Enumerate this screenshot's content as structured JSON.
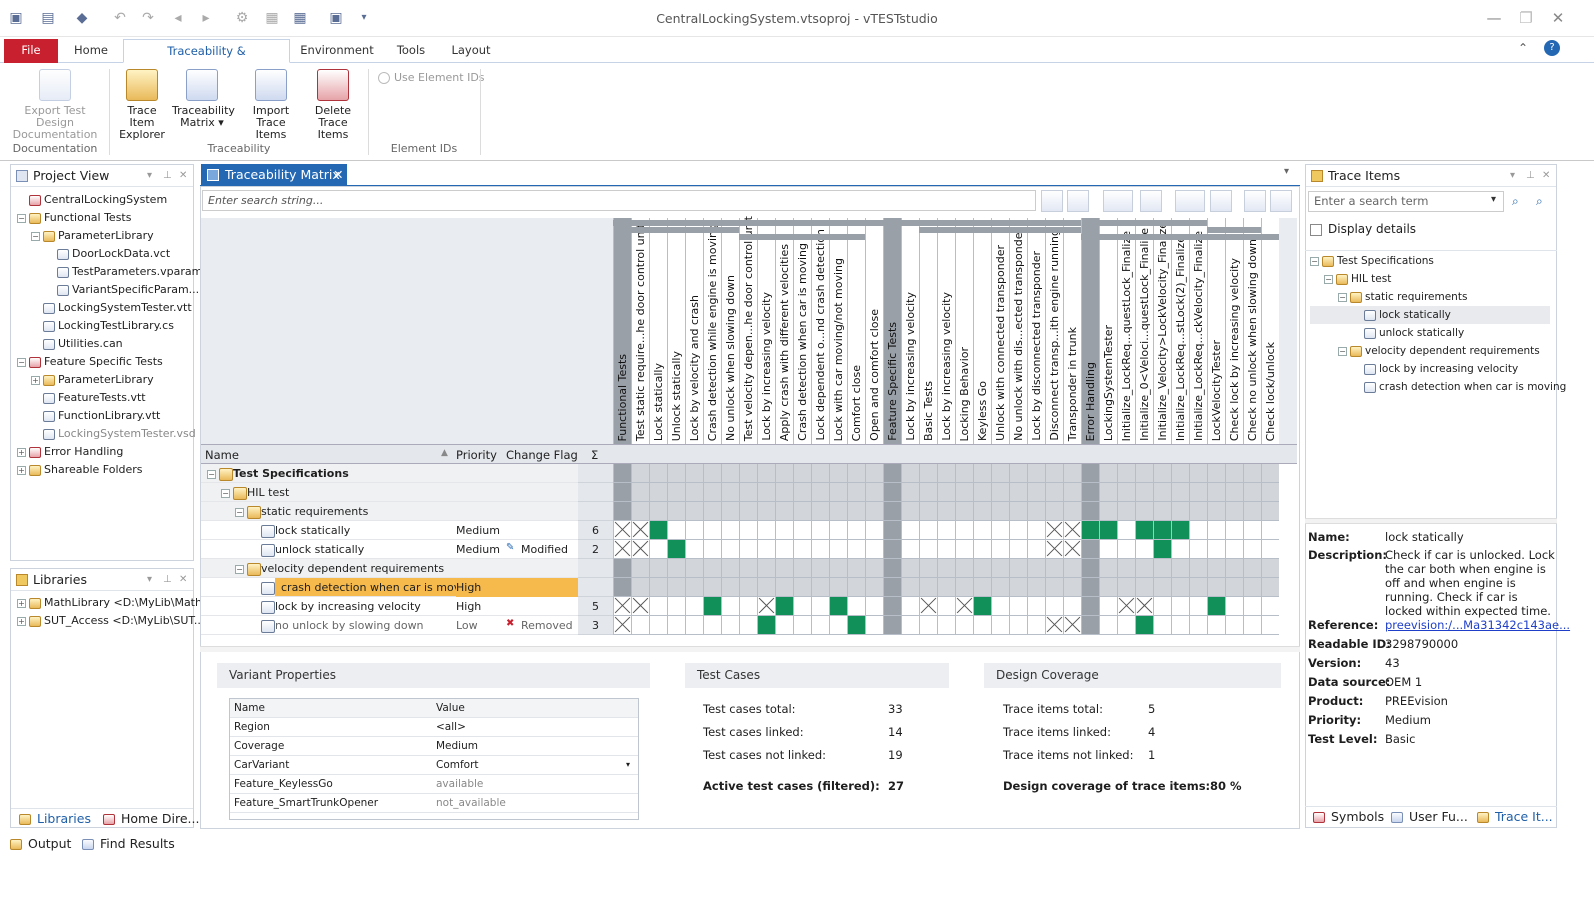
{
  "window": {
    "title": "CentralLockingSystem.vtsoproj - vTESTstudio"
  },
  "ribbon": {
    "tabs": [
      "File",
      "Home",
      "Traceability & Documentation",
      "Environment",
      "Tools",
      "Layout"
    ],
    "buttons": {
      "export": "Export Test Design Documentation",
      "trace_explorer": "Trace Item Explorer",
      "traceability_matrix": "Traceability Matrix ▾",
      "import": "Import Trace Items",
      "delete": "Delete Trace Items",
      "use_ids": "Use Element IDs"
    },
    "groups": [
      "Documentation",
      "Traceability",
      "Element IDs"
    ]
  },
  "project_view": {
    "title": "Project View",
    "items": [
      {
        "label": "CentralLockingSystem",
        "level": 0
      },
      {
        "label": "Functional Tests",
        "level": 0
      },
      {
        "label": "ParameterLibrary",
        "level": 1
      },
      {
        "label": "DoorLockData.vct",
        "level": 2
      },
      {
        "label": "TestParameters.vparam",
        "level": 2
      },
      {
        "label": "VariantSpecificParam...",
        "level": 2
      },
      {
        "label": "LockingSystemTester.vtt",
        "level": 1
      },
      {
        "label": "LockingTestLibrary.cs",
        "level": 1
      },
      {
        "label": "Utilities.can",
        "level": 1
      },
      {
        "label": "Feature Specific Tests",
        "level": 0
      },
      {
        "label": "ParameterLibrary",
        "level": 1
      },
      {
        "label": "FeatureTests.vtt",
        "level": 1
      },
      {
        "label": "FunctionLibrary.vtt",
        "level": 1
      },
      {
        "label": "LockingSystemTester.vsd",
        "level": 1
      },
      {
        "label": "Error Handling",
        "level": 0
      },
      {
        "label": "Shareable Folders",
        "level": 0
      }
    ]
  },
  "libraries": {
    "title": "Libraries",
    "items": [
      "MathLibrary <D:\\MyLib\\Math...",
      "SUT_Access <D:\\MyLib\\SUT..."
    ],
    "tabs": [
      "Libraries",
      "Home Dire..."
    ]
  },
  "matrix": {
    "tab_title": "Traceability Matrix",
    "search_placeholder": "Enter search string...",
    "columns": [
      {
        "label": "Functional Tests",
        "dark": true
      },
      {
        "label": "Test static require...he door control unit"
      },
      {
        "label": "Lock statically"
      },
      {
        "label": "Unlock statically"
      },
      {
        "label": "Lock by velocity and crash"
      },
      {
        "label": "Crash detection while engine is moving"
      },
      {
        "label": "No unlock when slowing down"
      },
      {
        "label": "Test velocity depen...he door control unit"
      },
      {
        "label": "Lock by increasing velocity"
      },
      {
        "label": "Apply crash with different velocities"
      },
      {
        "label": "Crash detection when car is moving"
      },
      {
        "label": "Lock dependent o...nd crash detection"
      },
      {
        "label": "Lock with car moving/not moving"
      },
      {
        "label": "Comfort close"
      },
      {
        "label": "Open and comfort close"
      },
      {
        "label": "Feature Specific Tests",
        "dark": true
      },
      {
        "label": "Lock by increasing velocity"
      },
      {
        "label": "Basic Tests"
      },
      {
        "label": "Lock by increasing velocity"
      },
      {
        "label": "Locking Behavior"
      },
      {
        "label": "Keyless Go"
      },
      {
        "label": "Unlock with connected transponder"
      },
      {
        "label": "No unlock with dis...ected transponder"
      },
      {
        "label": "Lock by disconnected transponder"
      },
      {
        "label": "Disconnect transp...ith engine running"
      },
      {
        "label": "Transponder in trunk"
      },
      {
        "label": "Error Handling",
        "dark": true
      },
      {
        "label": "LockingSystemTester"
      },
      {
        "label": "Initialize_LockReq...questLock_Finalize"
      },
      {
        "label": "Initialize_0<Veloci...questLock_Finalize"
      },
      {
        "label": "Initialize_Velocity>LockVelocity_Finalize"
      },
      {
        "label": "Initialize_LockReq...stLock(2)_Finalize"
      },
      {
        "label": "Initialize_LockReq...ckVelocity_Finalize"
      },
      {
        "label": "LockVelocityTester"
      },
      {
        "label": "Check lock by increasing velocity"
      },
      {
        "label": "Check no unlock when slowing down"
      },
      {
        "label": "Check lock/unlock"
      }
    ],
    "headers": {
      "name": "Name",
      "priority": "Priority",
      "change_flag": "Change Flag",
      "sigma": "Σ"
    },
    "rows": [
      {
        "name": "Test Specifications",
        "level": 0,
        "bold": true,
        "priority": "",
        "flag": "",
        "count": "",
        "type": "group",
        "cells": ""
      },
      {
        "name": "HIL test",
        "level": 1,
        "priority": "",
        "flag": "",
        "count": "",
        "type": "group",
        "cells": ""
      },
      {
        "name": "static requirements",
        "level": 2,
        "priority": "",
        "flag": "",
        "count": "",
        "type": "group",
        "cells": ""
      },
      {
        "name": "lock statically",
        "level": 3,
        "priority": "Medium",
        "flag": "",
        "count": "6",
        "type": "item",
        "cells": "XXS.....................XXSS.SSS......"
      },
      {
        "name": "unlock statically",
        "level": 3,
        "priority": "Medium",
        "flag": "Modified",
        "flag_icon": "pencil-icon",
        "count": "2",
        "type": "item",
        "cells": "XX.S....................XX....S......."
      },
      {
        "name": "velocity dependent requirements",
        "level": 2,
        "priority": "",
        "flag": "",
        "count": "",
        "type": "group",
        "cells": ""
      },
      {
        "name": "crash detection when car is moving",
        "level": 3,
        "priority": "High",
        "flag": "",
        "count": "",
        "type": "selected",
        "cells": ""
      },
      {
        "name": "lock by increasing velocity",
        "level": 3,
        "priority": "High",
        "flag": "",
        "count": "5",
        "type": "item",
        "cells": "XX...S..XS..S....X.XS.......XX...S...."
      },
      {
        "name": "no unlock by slowing down",
        "level": 3,
        "priority": "Low",
        "flag": "Removed",
        "flag_icon": "x-icon",
        "count": "3",
        "type": "removed",
        "cells": "X.......S....S..........XX...S......"
      }
    ]
  },
  "variant_properties": {
    "title": "Variant Properties",
    "headers": [
      "Name",
      "Value"
    ],
    "rows": [
      [
        "Region",
        "<all>"
      ],
      [
        "Coverage",
        "Medium"
      ],
      [
        "CarVariant",
        "Comfort"
      ],
      [
        "Feature_KeylessGo",
        "available"
      ],
      [
        "Feature_SmartTrunkOpener",
        "not_available"
      ]
    ]
  },
  "test_cases": {
    "title": "Test Cases",
    "rows": [
      [
        "Test cases total:",
        "33"
      ],
      [
        "Test cases linked:",
        "14"
      ],
      [
        "Test cases not linked:",
        "19"
      ]
    ],
    "active": [
      "Active test cases (filtered):",
      "27"
    ]
  },
  "design_coverage": {
    "title": "Design Coverage",
    "rows": [
      [
        "Trace items total:",
        "5"
      ],
      [
        "Trace items linked:",
        "4"
      ],
      [
        "Trace items not linked:",
        "1"
      ]
    ],
    "coverage": [
      "Design coverage of trace items:",
      "80 %"
    ]
  },
  "trace_items": {
    "title": "Trace Items",
    "search_placeholder": "Enter a search term",
    "display_details": "Display details",
    "tree": [
      {
        "label": "Test Specifications",
        "level": 0
      },
      {
        "label": "HIL test",
        "level": 1
      },
      {
        "label": "static requirements",
        "level": 2
      },
      {
        "label": "lock statically",
        "level": 3,
        "selected": true
      },
      {
        "label": "unlock statically",
        "level": 3
      },
      {
        "label": "velocity dependent requirements",
        "level": 2
      },
      {
        "label": "lock by increasing velocity",
        "level": 3
      },
      {
        "label": "crash detection when car is moving",
        "level": 3
      }
    ],
    "details": [
      [
        "Name:",
        "lock statically"
      ],
      [
        "Description:",
        "Check if car is unlocked. Lock the car both when engine is off and when engine is running. Check if car is locked within expected time."
      ],
      [
        "Reference:",
        "preevision:/...Ma31342c143ae..."
      ],
      [
        "Readable ID:",
        "3298790000"
      ],
      [
        "Version:",
        "43"
      ],
      [
        "Data source:",
        "OEM 1"
      ],
      [
        "Product:",
        "PREEvision"
      ],
      [
        "Priority:",
        "Medium"
      ],
      [
        "Test Level:",
        "Basic"
      ]
    ],
    "tabs": [
      "Symbols",
      "User Fu...",
      "Trace It..."
    ]
  },
  "bottom_tabs": [
    "Output",
    "Find Results"
  ],
  "colors": {
    "accent": "#2468b4",
    "file_tab": "#c8202f",
    "linked": "#11905a",
    "selected_row": "#f5b94c"
  }
}
